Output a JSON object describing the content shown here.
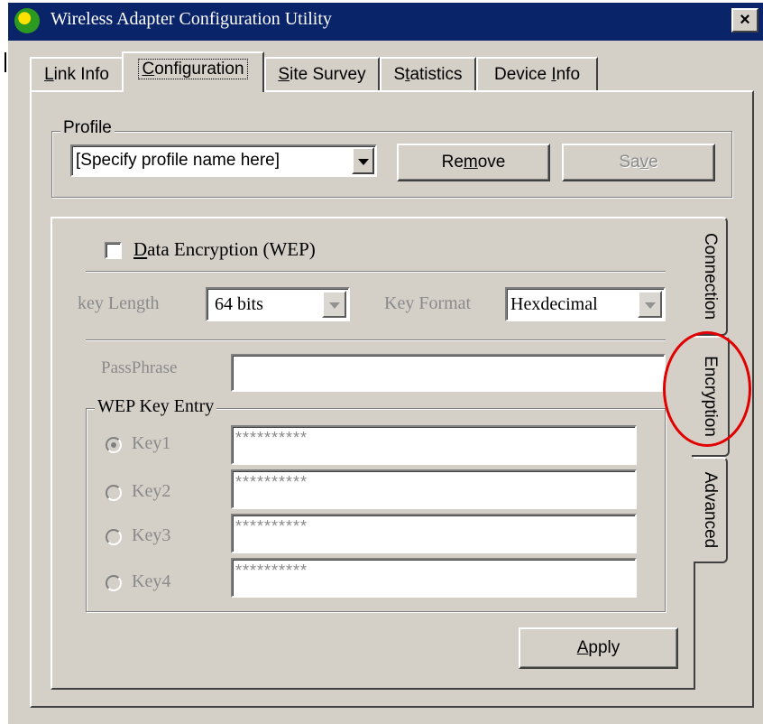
{
  "window": {
    "title": "Wireless Adapter Configuration Utility",
    "close_label": "×",
    "titlebar_color": "#0a246a"
  },
  "tabs": [
    {
      "prefix": "",
      "mnemonic": "L",
      "rest": "ink Info"
    },
    {
      "prefix": "",
      "mnemonic": "C",
      "rest": "onfiguration"
    },
    {
      "prefix": "",
      "mnemonic": "S",
      "rest": "ite Survey"
    },
    {
      "prefix": "S",
      "mnemonic": "t",
      "rest": "atistics"
    },
    {
      "prefix": "Device ",
      "mnemonic": "I",
      "rest": "nfo"
    }
  ],
  "profile": {
    "group_label": "Profile",
    "name_value": "[Specify profile name here]",
    "remove_prefix": "Re",
    "remove_mnemonic": "m",
    "remove_rest": "ove",
    "save_prefix": "Sa",
    "save_mnemonic": "v",
    "save_rest": "e"
  },
  "side_tabs": [
    "Connection",
    "Encryption",
    "Advanced"
  ],
  "encryption": {
    "checkbox_mnemonic": "D",
    "checkbox_rest": "ata Encryption (WEP)",
    "key_length_label": "key Length",
    "key_length_value": "64 bits",
    "key_format_label": "Key Format",
    "key_format_value": "Hexdecimal",
    "passphrase_label": "PassPhrase",
    "passphrase_value": "",
    "wep_group_label": "WEP Key Entry",
    "keys": [
      {
        "label": "Key1",
        "value": "**********",
        "selected": true
      },
      {
        "label": "Key2",
        "value": "**********",
        "selected": false
      },
      {
        "label": "Key3",
        "value": "**********",
        "selected": false
      },
      {
        "label": "Key4",
        "value": "**********",
        "selected": false
      }
    ],
    "apply_mnemonic": "A",
    "apply_rest": "pply"
  },
  "annotation": {
    "color": "#e00000"
  }
}
